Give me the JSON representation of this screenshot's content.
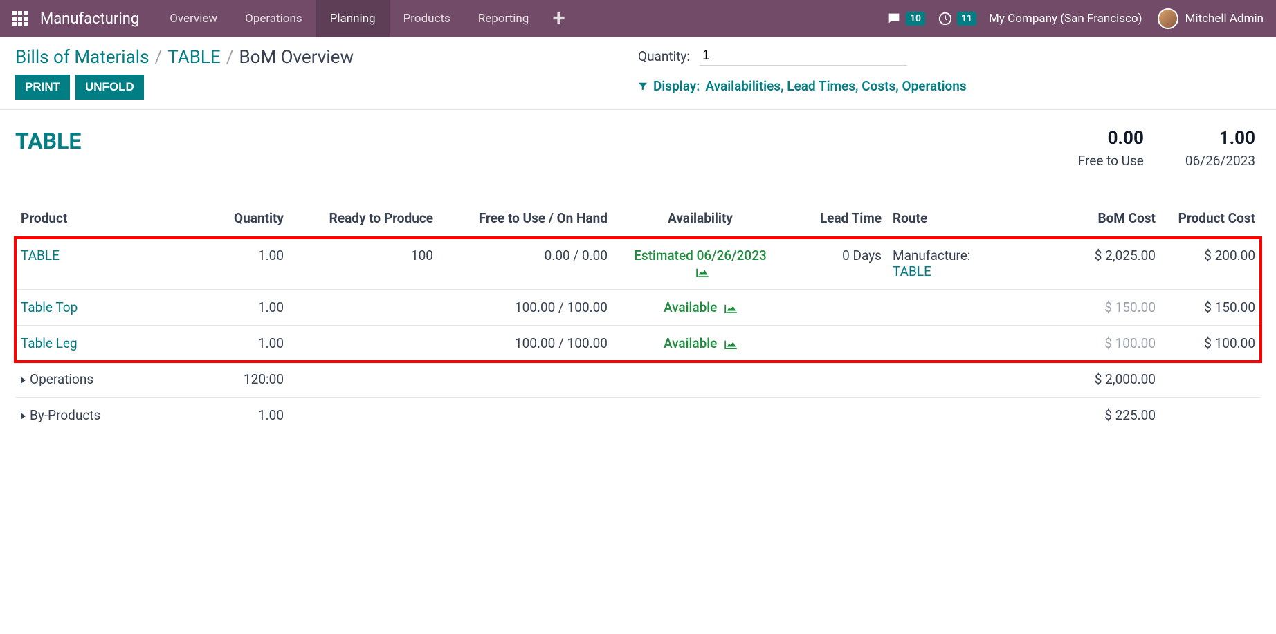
{
  "nav": {
    "brand": "Manufacturing",
    "items": [
      "Overview",
      "Operations",
      "Planning",
      "Products",
      "Reporting"
    ],
    "active_index": 2,
    "chat_badge": "10",
    "activity_badge": "11",
    "company": "My Company (San Francisco)",
    "user": "Mitchell Admin"
  },
  "breadcrumb": {
    "a": "Bills of Materials",
    "b": "TABLE",
    "c": "BoM Overview"
  },
  "actions": {
    "print": "PRINT",
    "unfold": "UNFOLD"
  },
  "quantity": {
    "label": "Quantity:",
    "value": "1"
  },
  "display_filter": {
    "prefix": "Display:",
    "opts": "Availabilities, Lead Times, Costs, Operations"
  },
  "summary": {
    "title": "TABLE",
    "metric1": {
      "value": "0.00",
      "label": "Free to Use"
    },
    "metric2": {
      "value": "1.00",
      "label": "06/26/2023"
    }
  },
  "columns": {
    "product": "Product",
    "quantity": "Quantity",
    "ready": "Ready to Produce",
    "free": "Free to Use / On Hand",
    "avail": "Availability",
    "lead": "Lead Time",
    "route": "Route",
    "bomcost": "BoM Cost",
    "prodcost": "Product Cost"
  },
  "rows": {
    "r0": {
      "product": "TABLE",
      "qty": "1.00",
      "ready": "100",
      "free": "0.00 / 0.00",
      "avail": "Estimated 06/26/2023",
      "lead": "0 Days",
      "route_a": "Manufacture:",
      "route_b": "TABLE",
      "bomcost": "$ 2,025.00",
      "prodcost": "$ 200.00"
    },
    "r1": {
      "product": "Table Top",
      "qty": "1.00",
      "free": "100.00 / 100.00",
      "avail": "Available",
      "bomcost": "$ 150.00",
      "prodcost": "$ 150.00"
    },
    "r2": {
      "product": "Table Leg",
      "qty": "1.00",
      "free": "100.00 / 100.00",
      "avail": "Available",
      "bomcost": "$ 100.00",
      "prodcost": "$ 100.00"
    },
    "r3": {
      "product": "Operations",
      "qty": "120:00",
      "bomcost": "$ 2,000.00"
    },
    "r4": {
      "product": "By-Products",
      "qty": "1.00",
      "bomcost": "$ 225.00"
    }
  }
}
